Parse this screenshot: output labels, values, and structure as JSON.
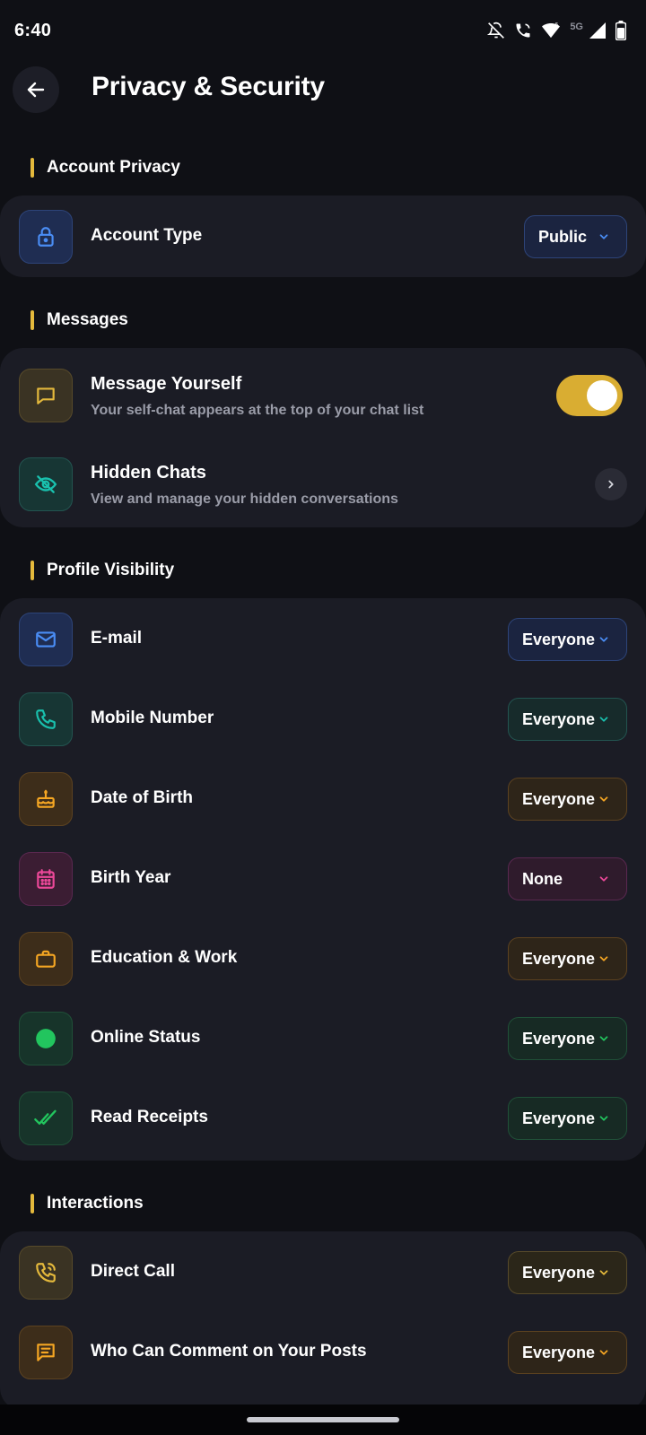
{
  "status_bar": {
    "time": "6:40",
    "network_label": "5G",
    "icons": [
      "notifications-off-icon",
      "wifi-calling-icon",
      "wifi-icon",
      "signal-icon",
      "battery-icon"
    ]
  },
  "header": {
    "title": "Privacy & Security",
    "back_icon": "arrow-left-icon"
  },
  "sections": {
    "account_privacy": {
      "title": "Account Privacy",
      "account_type": {
        "label": "Account Type",
        "value": "Public",
        "icon": "lock-icon",
        "accent": "#3b82f6"
      }
    },
    "messages": {
      "title": "Messages",
      "message_yourself": {
        "label": "Message Yourself",
        "subtitle": "Your self-chat appears at the top of your chat list",
        "icon": "chat-bubble-icon",
        "toggle_on": true,
        "accent": "#e4b93c"
      },
      "hidden_chats": {
        "label": "Hidden Chats",
        "subtitle": "View and manage your hidden conversations",
        "icon": "eye-off-icon",
        "accent": "#14b8a6"
      }
    },
    "profile_visibility": {
      "title": "Profile Visibility",
      "email": {
        "label": "E-mail",
        "value": "Everyone",
        "icon": "mail-icon",
        "accent": "#3b82f6"
      },
      "mobile_number": {
        "label": "Mobile Number",
        "value": "Everyone",
        "icon": "phone-icon",
        "accent": "#14b8a6"
      },
      "date_of_birth": {
        "label": "Date of Birth",
        "value": "Everyone",
        "icon": "cake-icon",
        "accent": "#f59e0b"
      },
      "birth_year": {
        "label": "Birth Year",
        "value": "None",
        "icon": "calendar-icon",
        "accent": "#ec4899"
      },
      "education_work": {
        "label": "Education & Work",
        "value": "Everyone",
        "icon": "briefcase-icon",
        "accent": "#f59e0b"
      },
      "online_status": {
        "label": "Online Status",
        "value": "Everyone",
        "icon": "online-dot-icon",
        "accent": "#22c55e"
      },
      "read_receipts": {
        "label": "Read Receipts",
        "value": "Everyone",
        "icon": "double-check-icon",
        "accent": "#22c55e"
      }
    },
    "interactions": {
      "title": "Interactions",
      "direct_call": {
        "label": "Direct Call",
        "value": "Everyone",
        "icon": "phone-ringing-icon",
        "accent": "#e4b93c"
      },
      "comments": {
        "label": "Who Can Comment on Your Posts",
        "value": "Everyone",
        "icon": "comment-icon",
        "accent": "#f59e0b"
      }
    }
  }
}
